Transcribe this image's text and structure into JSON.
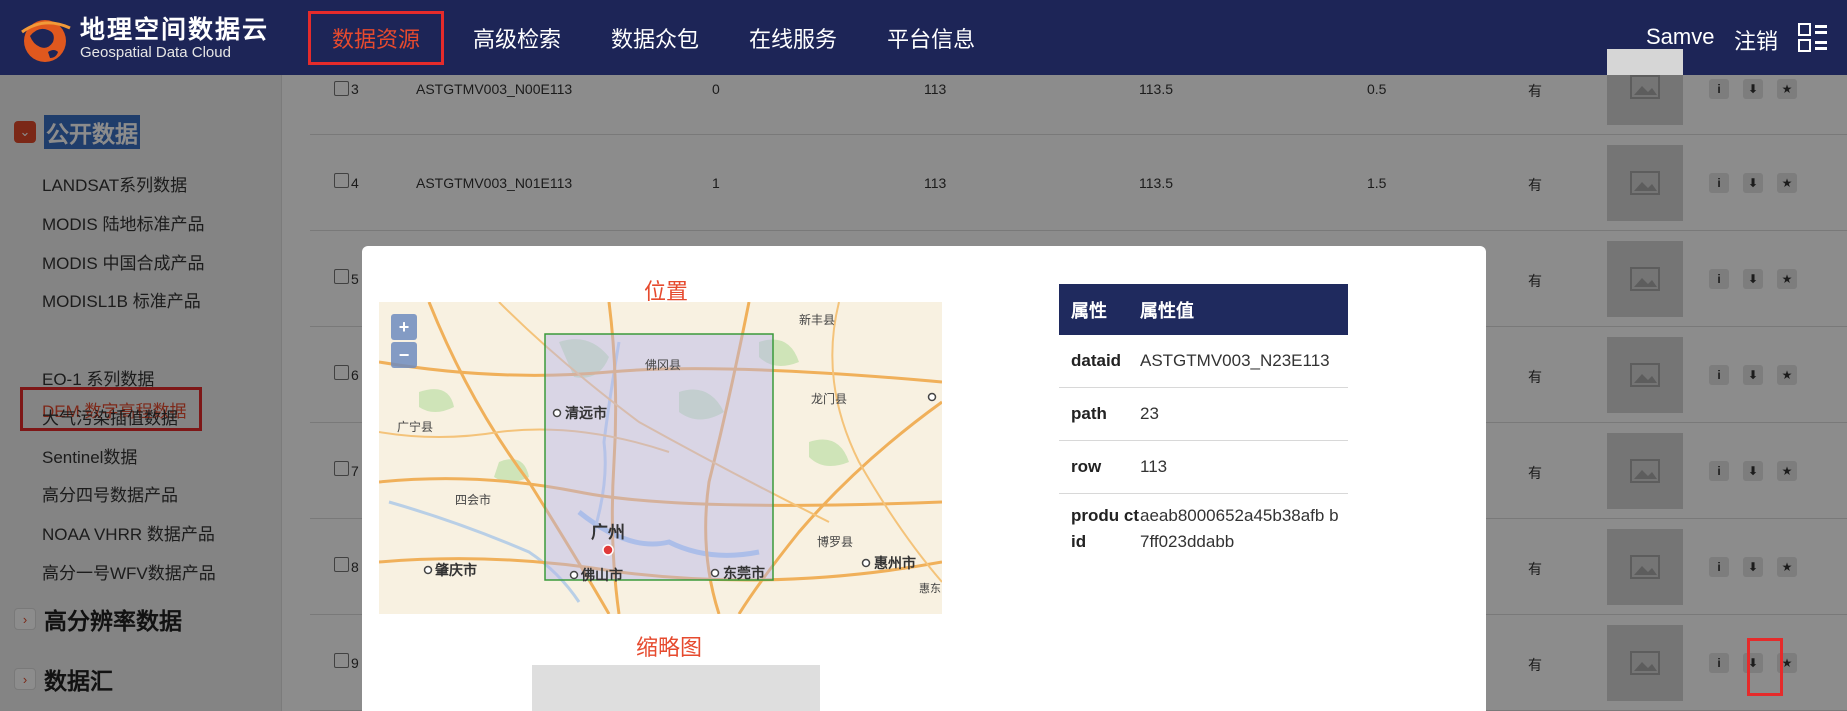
{
  "header": {
    "logo_cn": "地理空间数据云",
    "logo_en": "Geospatial Data Cloud",
    "nav": [
      "数据资源",
      "高级检索",
      "数据众包",
      "在线服务",
      "平台信息"
    ],
    "user": "Samve",
    "logout": "注销"
  },
  "sidebar": {
    "public": "公开数据",
    "items": [
      "LANDSAT系列数据",
      "MODIS 陆地标准产品",
      "MODIS 中国合成产品",
      "MODISL1B 标准产品",
      "DEM 数字高程数据",
      "EO-1 系列数据",
      "大气污染插值数据",
      "Sentinel数据",
      "高分四号数据产品",
      "NOAA VHRR 数据产品",
      "高分一号WFV数据产品"
    ],
    "hires": "高分辨率数据",
    "hub": "数据汇"
  },
  "table": {
    "rows": [
      {
        "idx": "3",
        "name": "ASTGTMV003_N00E113",
        "c1": "0",
        "c2": "113",
        "c3": "113.5",
        "c4": "0.5",
        "c5": "有"
      },
      {
        "idx": "4",
        "name": "ASTGTMV003_N01E113",
        "c1": "1",
        "c2": "113",
        "c3": "113.5",
        "c4": "1.5",
        "c5": "有"
      },
      {
        "idx": "5",
        "name": "",
        "c1": "",
        "c2": "",
        "c3": "",
        "c4": "",
        "c5": "有"
      },
      {
        "idx": "6",
        "name": "",
        "c1": "",
        "c2": "",
        "c3": "",
        "c4": "",
        "c5": "有"
      },
      {
        "idx": "7",
        "name": "",
        "c1": "",
        "c2": "",
        "c3": "",
        "c4": "",
        "c5": "有"
      },
      {
        "idx": "8",
        "name": "",
        "c1": "",
        "c2": "",
        "c3": "",
        "c4": "",
        "c5": "有"
      },
      {
        "idx": "9",
        "name": "",
        "c1": "",
        "c2": "",
        "c3": "",
        "c4": "",
        "c5": "有"
      }
    ],
    "actions": {
      "info": "i",
      "download": "⬇",
      "favorite": "★"
    }
  },
  "modal": {
    "map_title": "位置",
    "zoom_in": "+",
    "zoom_out": "−",
    "map_labels": {
      "xinfeng": "新丰县",
      "fogang": "佛冈县",
      "qingyuan": "清远市",
      "longmen": "龙门县",
      "guangning": "广宁县",
      "sihui": "四会市",
      "guangzhou": "广州",
      "boluo": "博罗县",
      "huizhou": "惠州市",
      "zhaoqing": "肇庆市",
      "foshan": "佛山市",
      "dongguan": "东莞市",
      "huidong": "惠东"
    },
    "thumb_title": "缩略图",
    "attr_header": [
      "属性",
      "属性值"
    ],
    "attrs": [
      {
        "k": "dataid",
        "v": "ASTGTMV003_N23E113"
      },
      {
        "k": "path",
        "v": "23"
      },
      {
        "k": "row",
        "v": "113"
      },
      {
        "k": "produ ctid",
        "v": "aeab8000652a45b38afb b7ff023ddabb"
      }
    ]
  }
}
